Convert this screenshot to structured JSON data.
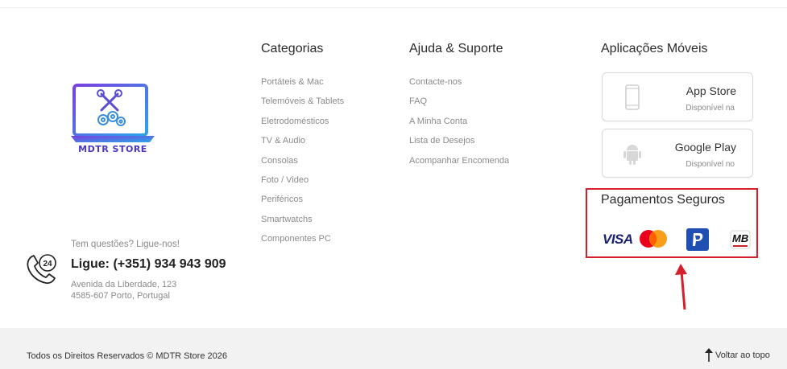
{
  "logo": {
    "text": "MDTR STORE",
    "icon": "laptop-tools-gears-logo"
  },
  "columns": {
    "categories": {
      "title": "Categorias",
      "items": [
        "Portáteis & Mac",
        "Telemóveis & Tablets",
        "Eletrodomésticos",
        "TV & Audio",
        "Consolas",
        "Foto / Video",
        "Periféricos",
        "Smartwatchs",
        "Componentes PC"
      ]
    },
    "help": {
      "title": "Ajuda & Suporte",
      "items": [
        "Contacte-nos",
        "FAQ",
        "A Minha Conta",
        "Lista de Desejos",
        "Acompanhar Encomenda"
      ]
    },
    "apps": {
      "title": "Aplicações Móveis",
      "app_store": {
        "name": "App Store",
        "sub": "Disponível na",
        "icon": "smartphone-icon"
      },
      "google_play": {
        "name": "Google Play",
        "sub": "Disponível no",
        "icon": "android-icon"
      }
    }
  },
  "contact": {
    "question": "Tem questões? Ligue-nos!",
    "phone": "Ligue: (+351) 934 943 909",
    "address_line1": "Avenida da Liberdade, 123",
    "address_line2": "4585-607 Porto, Portugal",
    "icon": "phone-24h-icon"
  },
  "payments": {
    "title": "Pagamentos Seguros",
    "methods": [
      "visa",
      "mastercard",
      "paypal",
      "multibanco"
    ],
    "visa_text": "VISA",
    "mb_text": "MB"
  },
  "footer": {
    "copyright": "Todos os Direitos Reservados © MDTR Store 2026",
    "back_to_top": "Voltar ao topo"
  },
  "colors": {
    "accent_red": "#d71f2b",
    "logo_blue": "#2aa6e8",
    "logo_purple": "#7a3fe0",
    "bottom_bar": "#f2f2f2",
    "muted_text": "#8a8a8a"
  }
}
